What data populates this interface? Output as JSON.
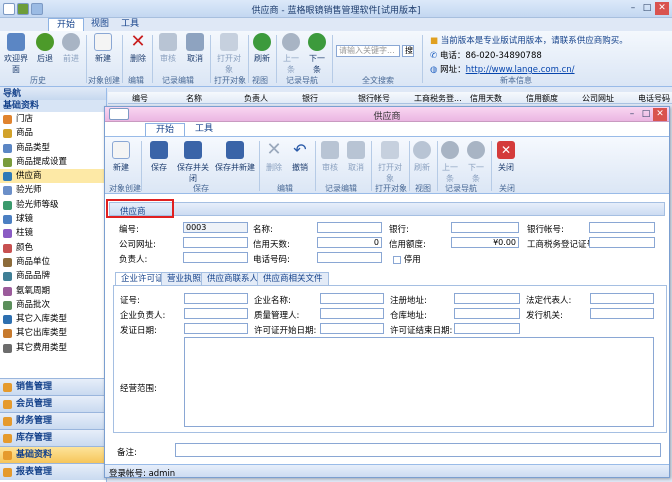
{
  "app": {
    "title": "供应商 - 蓝格眼镜销售管理软件[试用版本]"
  },
  "outer_tabs": [
    "开始",
    "视图",
    "工具"
  ],
  "outer_ribbon": {
    "buttons": [
      "欢迎界面",
      "后退",
      "前进",
      "新建",
      "删除",
      "审核",
      "取消",
      "打开对象",
      "刷新",
      "上一条",
      "下一条"
    ],
    "groups": [
      "历史",
      "对象创建",
      "编辑",
      "记录编辑",
      "打开对象",
      "视图",
      "记录导航",
      "全文搜索",
      "新本信息"
    ],
    "search_placeholder": "请输入关键字...",
    "search_btn": "搜",
    "notice": "当前版本是专业版试用版本，请联系供应商购买。",
    "phone_label": "电话：",
    "phone": "86-020-34890788",
    "site_label": "网址：",
    "site": "http://www.lange.com.cn/"
  },
  "nav": {
    "header": "导航",
    "section": "基础资料",
    "items": [
      "门店",
      "商品",
      "商品类型",
      "商品提成设置",
      "供应商",
      "验光师",
      "验光师等级",
      "球镜",
      "柱镜",
      "颜色",
      "商品单位",
      "商品品牌",
      "氨氧周期",
      "商品批次",
      "其它入库类型",
      "其它出库类型",
      "其它费用类型"
    ],
    "selected": "供应商",
    "bottom": [
      "销售管理",
      "会员管理",
      "财务管理",
      "库存管理",
      "基础资料",
      "报表管理"
    ]
  },
  "grid_headers": [
    "编号",
    "名称",
    "负责人",
    "银行",
    "银行帐号",
    "工商税务登...",
    "信用天数",
    "信用额度",
    "公司网址",
    "电话号码"
  ],
  "inner": {
    "title": "供应商",
    "tabs": [
      "开始",
      "工具"
    ],
    "buttons": [
      "新建",
      "保存",
      "保存并关闭",
      "保存并新建",
      "删除",
      "撤销",
      "审核",
      "取消",
      "打开对象",
      "刷新",
      "上一条",
      "下一条",
      "关闭"
    ],
    "groups": [
      "对象创建",
      "保存",
      "编辑",
      "记录编辑",
      "打开对象",
      "视图",
      "记录导航",
      "关闭"
    ],
    "section": "供应商",
    "form": {
      "code_label": "编号:",
      "code": "0003",
      "name_label": "名称:",
      "bank_label": "银行:",
      "account_label": "银行帐号:",
      "website_label": "公司网址:",
      "days_label": "信用天数:",
      "days": "0",
      "limit_label": "信用额度:",
      "limit": "¥0.00",
      "tax_label": "工商税务登记证号:",
      "person_label": "负责人:",
      "tel_label": "电话号码:",
      "disabled_label": "停用"
    },
    "subtabs": [
      "企业许可证",
      "营业执照",
      "供应商联系人",
      "供应商相关文件"
    ],
    "license": {
      "no": "证号:",
      "company": "企业名称:",
      "addr": "注册地址:",
      "legal": "法定代表人:",
      "owner": "企业负责人:",
      "quality": "质量管理人:",
      "warehouse": "仓库地址:",
      "issuer": "发行机关:",
      "issue_date": "发证日期:",
      "start": "许可证开始日期:",
      "end": "许可证结束日期:",
      "scope": "经营范围:"
    },
    "remark_label": "备注:",
    "status": "登录帐号: admin"
  },
  "colors": {
    "accent": "#15428b",
    "ribbon": "#dbe6f5",
    "title_pink": "#ebb6e2",
    "highlight": "#e02020"
  }
}
